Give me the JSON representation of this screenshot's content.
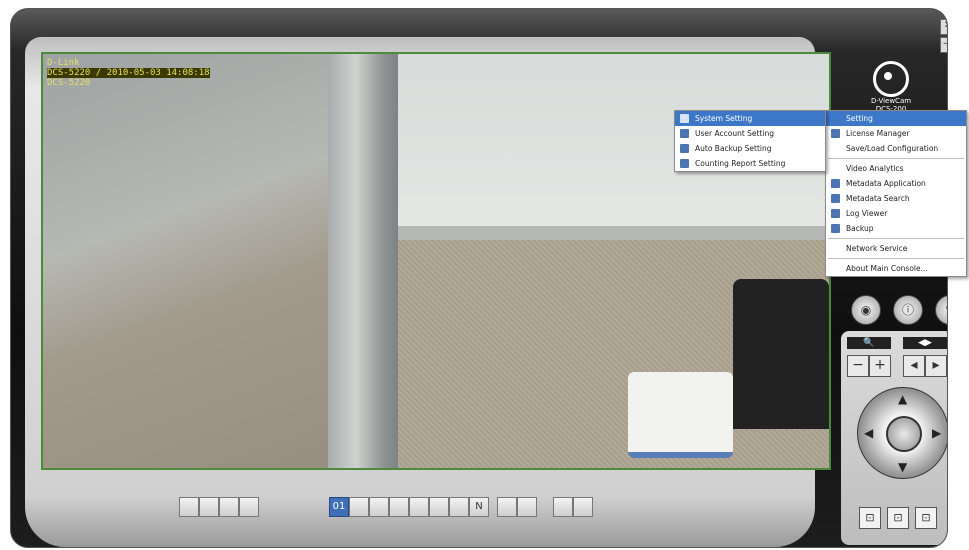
{
  "window": {
    "close_label": "✕",
    "minimize_label": "—"
  },
  "logo": {
    "brand": "D-ViewCam",
    "model": "DCS-200"
  },
  "video": {
    "overlay_line1": "D-Link",
    "overlay_line2": "DCS-5220 / 2010-05-03 14:08:18",
    "overlay_line3": "DCS-5220"
  },
  "main_menu": {
    "items": [
      {
        "label": "Setting",
        "icon": "gear-icon",
        "selected": true
      },
      {
        "label": "License Manager",
        "icon": "license-icon"
      },
      {
        "label": "Save/Load Configuration",
        "icon": ""
      },
      {
        "label": "Video Analytics",
        "icon": ""
      },
      {
        "label": "Metadata Application",
        "icon": "metadata-icon"
      },
      {
        "label": "Metadata Search",
        "icon": "search-icon"
      },
      {
        "label": "Log Viewer",
        "icon": "log-icon"
      },
      {
        "label": "Backup",
        "icon": "backup-icon"
      },
      {
        "label": "Network Service",
        "icon": ""
      },
      {
        "label": "About Main Console...",
        "icon": ""
      }
    ]
  },
  "sub_menu": {
    "items": [
      {
        "label": "System Setting",
        "icon": "system-icon",
        "selected": true
      },
      {
        "label": "User Account Setting",
        "icon": "user-icon"
      },
      {
        "label": "Auto Backup Setting",
        "icon": "backup-icon"
      },
      {
        "label": "Counting Report Setting",
        "icon": "report-icon"
      }
    ]
  },
  "layout_bar": {
    "n_label": "N",
    "one_label": "01"
  },
  "ptz": {
    "zoom_header": "🔍",
    "focus_header": "◀▶",
    "minus": "−",
    "plus": "+"
  },
  "colors": {
    "accent": "#3d78c8",
    "video_border": "#4a8a3a",
    "overlay_text": "#e8e060"
  }
}
